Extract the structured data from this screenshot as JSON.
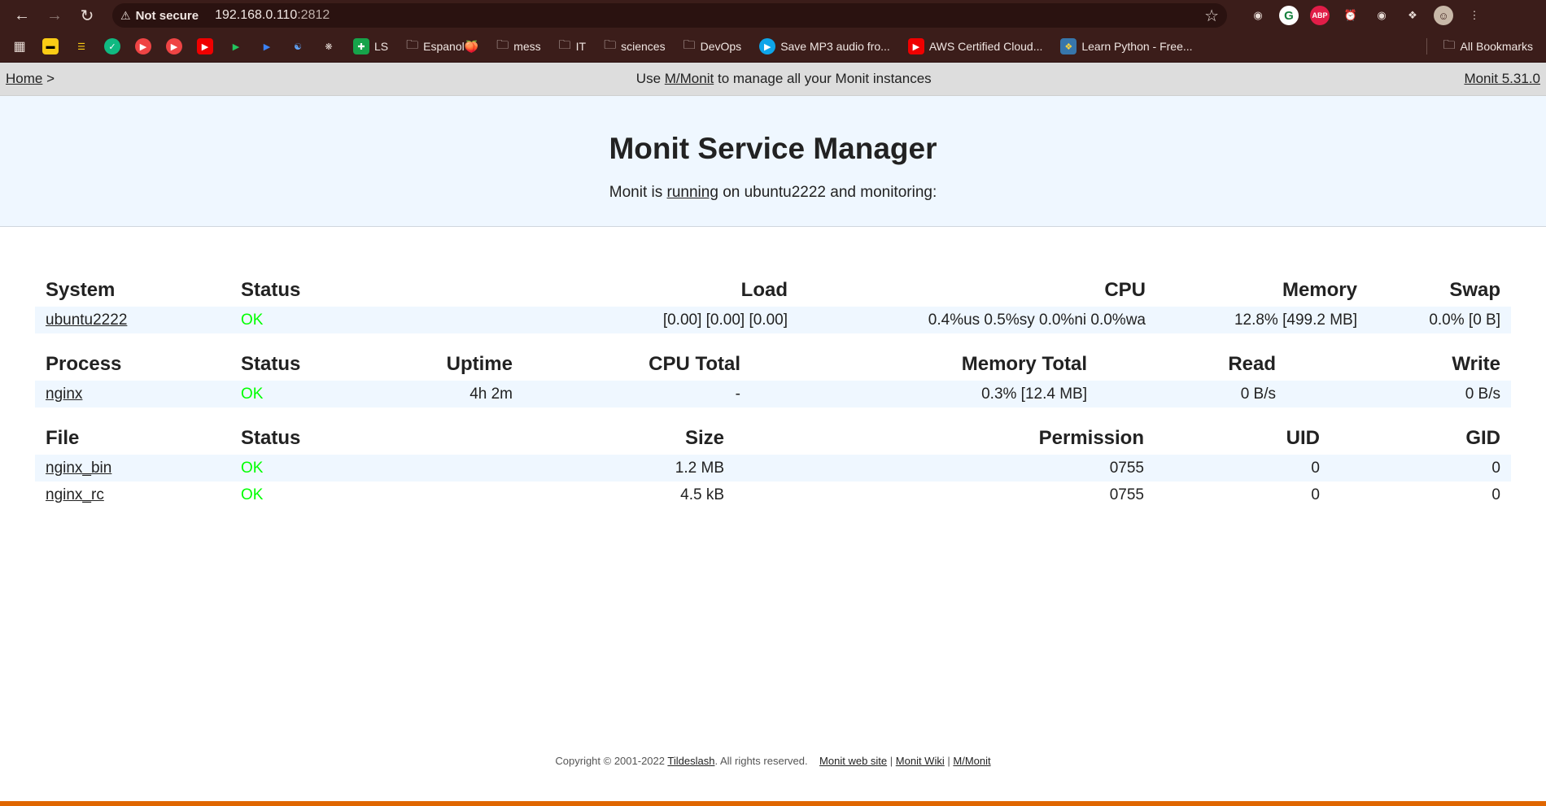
{
  "browser": {
    "not_secure": "Not secure",
    "url_host": "192.168.0.110",
    "url_port": ":2812",
    "bookmarks": [
      {
        "label": "LS",
        "icon": "sheets-icon"
      },
      {
        "label": "Espanol🍑",
        "icon": "folder-icon"
      },
      {
        "label": "mess",
        "icon": "folder-icon"
      },
      {
        "label": "IT",
        "icon": "folder-icon"
      },
      {
        "label": "sciences",
        "icon": "folder-icon"
      },
      {
        "label": "DevOps",
        "icon": "folder-icon"
      },
      {
        "label": "Save MP3 audio fro...",
        "icon": "play-icon"
      },
      {
        "label": "AWS Certified Cloud...",
        "icon": "youtube-icon"
      },
      {
        "label": "Learn Python - Free...",
        "icon": "python-icon"
      }
    ],
    "all_bookmarks": "All Bookmarks"
  },
  "monit_nav": {
    "home": "Home",
    "home_sep": ">",
    "use": "Use",
    "mmonit": "M/Monit",
    "manage": "to manage all your Monit instances",
    "version": "Monit 5.31.0"
  },
  "banner": {
    "title": "Monit Service Manager",
    "pre": "Monit is",
    "running": "running",
    "post": "on ubuntu2222 and monitoring:"
  },
  "system_table": {
    "headers": [
      "System",
      "Status",
      "Load",
      "CPU",
      "Memory",
      "Swap"
    ],
    "rows": [
      [
        "ubuntu2222",
        "OK",
        "[0.00] [0.00] [0.00]",
        "0.4%us 0.5%sy 0.0%ni 0.0%wa",
        "12.8% [499.2 MB]",
        "0.0% [0 B]"
      ]
    ]
  },
  "process_table": {
    "headers": [
      "Process",
      "Status",
      "Uptime",
      "CPU Total",
      "Memory Total",
      "Read",
      "Write"
    ],
    "rows": [
      [
        "nginx",
        "OK",
        "4h 2m",
        "-",
        "0.3% [12.4 MB]",
        "0 B/s",
        "0 B/s"
      ]
    ]
  },
  "file_table": {
    "headers": [
      "File",
      "Status",
      "Size",
      "Permission",
      "UID",
      "GID"
    ],
    "rows": [
      [
        "nginx_bin",
        "OK",
        "1.2 MB",
        "0755",
        "0",
        "0"
      ],
      [
        "nginx_rc",
        "OK",
        "4.5 kB",
        "0755",
        "0",
        "0"
      ]
    ]
  },
  "footer": {
    "copyright": "Copyright © 2001-2022",
    "tildeslash": "Tildeslash",
    "rights": ". All rights reserved.",
    "website": "Monit web site",
    "wiki": "Monit Wiki",
    "mmonit": "M/Monit",
    "sep": "|"
  },
  "colors": {
    "ok": "#00ff00",
    "banner_bg": "#eff7ff",
    "nav_bg": "#dddddd",
    "accent_line": "#e06600"
  }
}
